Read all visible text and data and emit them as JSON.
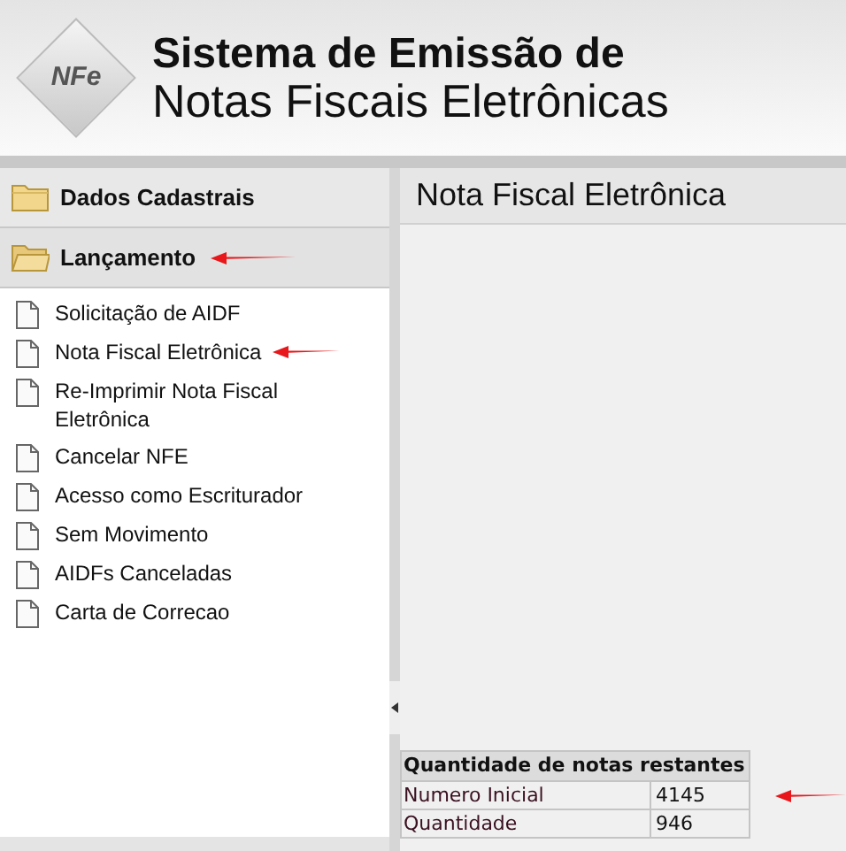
{
  "header": {
    "logo_text": "NFe",
    "title_line_1": "Sistema de Emissão de",
    "title_line_2": "Notas Fiscais Eletrônicas"
  },
  "sidebar": {
    "sections": [
      {
        "label": "Dados Cadastrais",
        "expanded": false,
        "arrow": false
      },
      {
        "label": "Lançamento",
        "expanded": true,
        "arrow": true,
        "items": [
          {
            "label": "Solicitação de AIDF",
            "arrow": false
          },
          {
            "label": "Nota Fiscal Eletrônica",
            "arrow": true
          },
          {
            "label": "Re-Imprimir Nota Fiscal Eletrônica",
            "arrow": false
          },
          {
            "label": "Cancelar NFE",
            "arrow": false
          },
          {
            "label": "Acesso como Escriturador",
            "arrow": false
          },
          {
            "label": "Sem Movimento",
            "arrow": false
          },
          {
            "label": "AIDFs Canceladas",
            "arrow": false
          },
          {
            "label": "Carta de Correcao",
            "arrow": false
          }
        ]
      }
    ]
  },
  "main": {
    "title": "Nota Fiscal Eletrônica",
    "table": {
      "heading": "Quantidade de notas restantes",
      "rows": [
        {
          "label": "Numero Inicial",
          "value": "4145",
          "arrow": true
        },
        {
          "label": "Quantidade",
          "value": "946",
          "arrow": false
        }
      ]
    }
  }
}
